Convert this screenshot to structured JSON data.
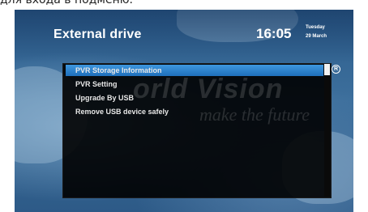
{
  "caption": "для входа в подменю.",
  "header": {
    "title": "External drive",
    "time": "16:05",
    "day": "Tuesday",
    "date": "29 March"
  },
  "watermark": {
    "line1": "orld Vision",
    "line2": "make the future"
  },
  "menu": {
    "items": [
      {
        "label": "PVR Storage Information",
        "selected": true
      },
      {
        "label": "PVR Setting",
        "selected": false
      },
      {
        "label": "Upgrade By USB",
        "selected": false
      },
      {
        "label": "Remove USB device safely",
        "selected": false
      }
    ]
  },
  "badge": {
    "label": "R"
  },
  "colors": {
    "highlight": "#2a7fcc",
    "panel": "#000000",
    "background": "#2f5f8e"
  }
}
